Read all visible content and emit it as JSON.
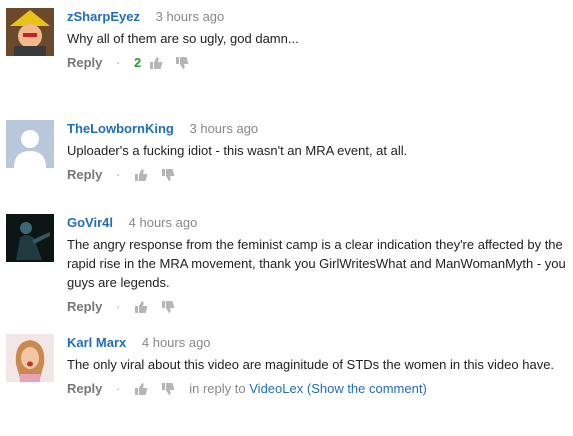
{
  "comments": [
    {
      "author": "zSharpEyez",
      "time": "3 hours ago",
      "text": "Why all of them are so ugly, god damn...",
      "reply_label": "Reply",
      "separator": "·",
      "likes": "2",
      "avatar": "cartoon-character-avatar"
    },
    {
      "author": "TheLowbornKing",
      "time": "3 hours ago",
      "text": "Uploader's a fucking idiot - this wasn't an MRA event, at all.",
      "reply_label": "Reply",
      "separator": "·",
      "avatar": "default-user-avatar"
    },
    {
      "author": "GoVir4l",
      "time": "4 hours ago",
      "text": "The angry response from the feminist camp is a clear indication they're affected by the rapid rise in the MRA movement, thank you GirlWritesWhat and ManWomanMyth - you guys are legends.",
      "reply_label": "Reply",
      "separator": "·",
      "avatar": "dark-figure-avatar"
    },
    {
      "author": "Karl Marx",
      "time": "4 hours ago",
      "text": "The only viral about this video are maginitude of STDs the women in this video have.",
      "reply_label": "Reply",
      "separator": "·",
      "in_reply_prefix": "in reply to",
      "reply_target": "VideoLex",
      "show_comment": "(Show the comment)",
      "avatar": "woman-photo-avatar"
    }
  ],
  "colors": {
    "author": "#1f6dbf",
    "timestamp": "#888888",
    "likes": "#2b9a2b",
    "icon": "#b5b5b5"
  },
  "icons": [
    "thumbs-up-icon",
    "thumbs-down-icon"
  ]
}
